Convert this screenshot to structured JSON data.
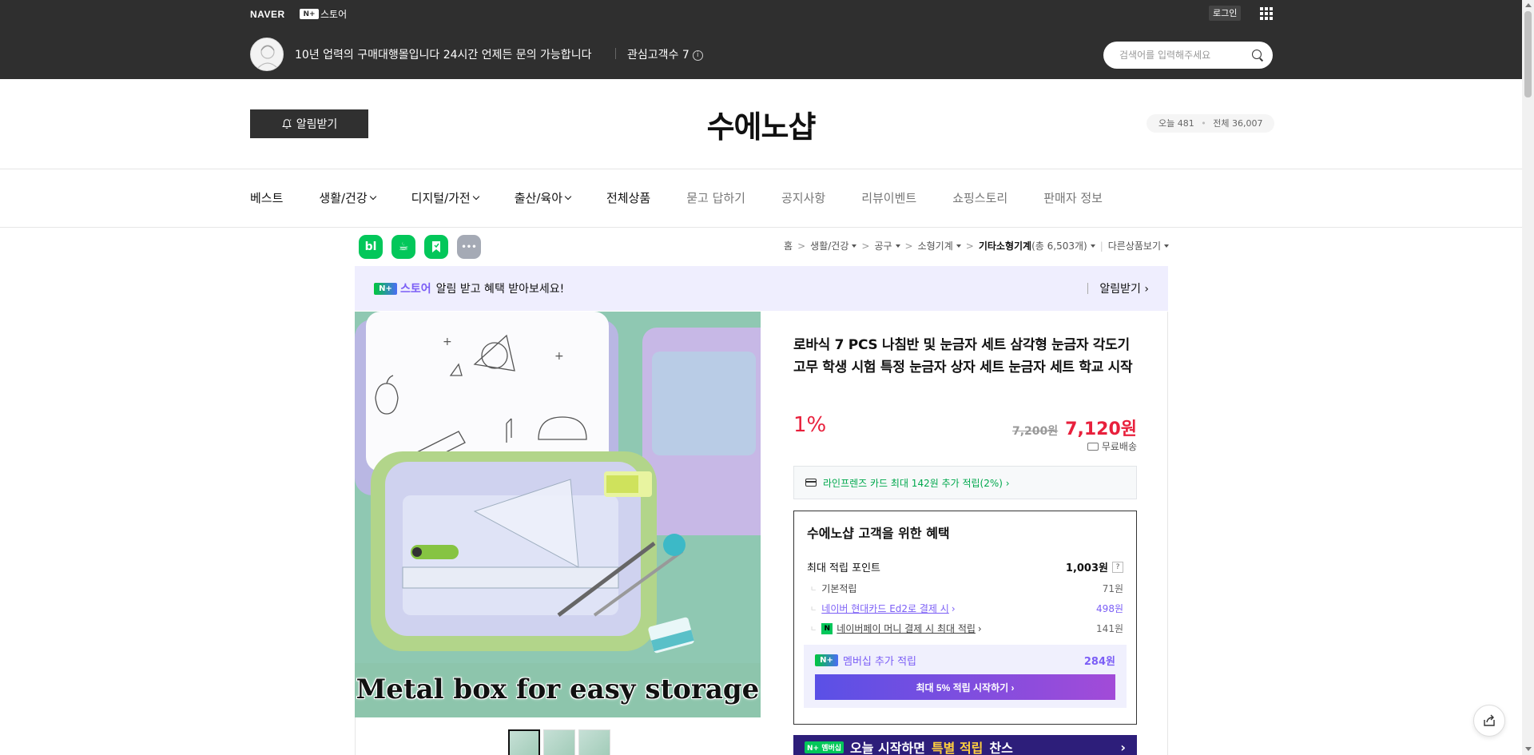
{
  "header": {
    "naver": "NAVER",
    "store_badge": "N+",
    "store_label": "스토어",
    "login": "로그인",
    "store_desc": "10년 업력의 구매대행몰입니다 24시간 언제든 문의 가능합니다",
    "fav_label": "관심고객수 7",
    "search_placeholder": "검색어를 입력해주세요"
  },
  "store": {
    "alarm_btn": "알림받기",
    "title": "수에노샵",
    "visit_today": "오늘 481",
    "visit_total": "전체 36,007"
  },
  "nav": {
    "items": [
      {
        "label": "베스트"
      },
      {
        "label": "생활/건강"
      },
      {
        "label": "디지털/가전"
      },
      {
        "label": "출산/육아"
      },
      {
        "label": "전체상품"
      },
      {
        "label": "묻고 답하기"
      },
      {
        "label": "공지사항"
      },
      {
        "label": "리뷰이벤트"
      },
      {
        "label": "쇼핑스토리"
      },
      {
        "label": "판매자 정보"
      }
    ]
  },
  "share": {
    "blog": "bl",
    "cafe": "☕",
    "band": "▶",
    "more": "•••"
  },
  "breadcrumb": {
    "home": "홈",
    "c1": "생활/건강",
    "c2": "공구",
    "c3": "소형기계",
    "c4": "기타소형기계",
    "c4_count": "(총 6,503개)",
    "other": "다른상품보기"
  },
  "banner": {
    "badge": "N+",
    "store": "스토어",
    "text": "알림 받고 혜택 받아보세요!",
    "action": "알림받기 ›"
  },
  "image": {
    "caption": "Metal box for easy storage"
  },
  "product": {
    "name": "로바식 7 PCS 나침반 및 눈금자 세트 삼각형 눈금자 각도기 고무 학생 시험 특정 눈금자 상자 세트 눈금자 세트 학교 시작",
    "discount": "1%",
    "orig_price": "7,200원",
    "sale_price": "7,120원",
    "shipping": "무료배송",
    "card_benefit": "라인프렌즈 카드 최대 142원 추가 적립(2%) ›"
  },
  "benefits": {
    "title": "수에노샵 고객을 위한 혜택",
    "max_point_label": "최대 적립 포인트",
    "max_point_value": "1,003원",
    "q": "?",
    "base_label": "기본적립",
    "base_value": "71원",
    "hyundai_label": "네이버 현대카드 Ed2로 결제 시",
    "hyundai_value": "498원",
    "npay_badge": "N",
    "npay_label": "네이버페이 머니 결제 시 최대 적립",
    "npay_value": "141원",
    "member_badge": "N+",
    "member_label": "멤버십 추가 적립",
    "member_value": "284원",
    "member_btn": "최대 5% 적립 시작하기 ›"
  },
  "promo": {
    "tag": "N+ 멤버십",
    "text1": "오늘 시작하면",
    "text2": "특별 적립",
    "text3": "찬스",
    "arrow": "›"
  },
  "colors": {
    "header_bg": "#2f2f2f",
    "accent_green": "#03c75a",
    "accent_purple": "#7b5ef6",
    "price_red": "#e8203c"
  }
}
